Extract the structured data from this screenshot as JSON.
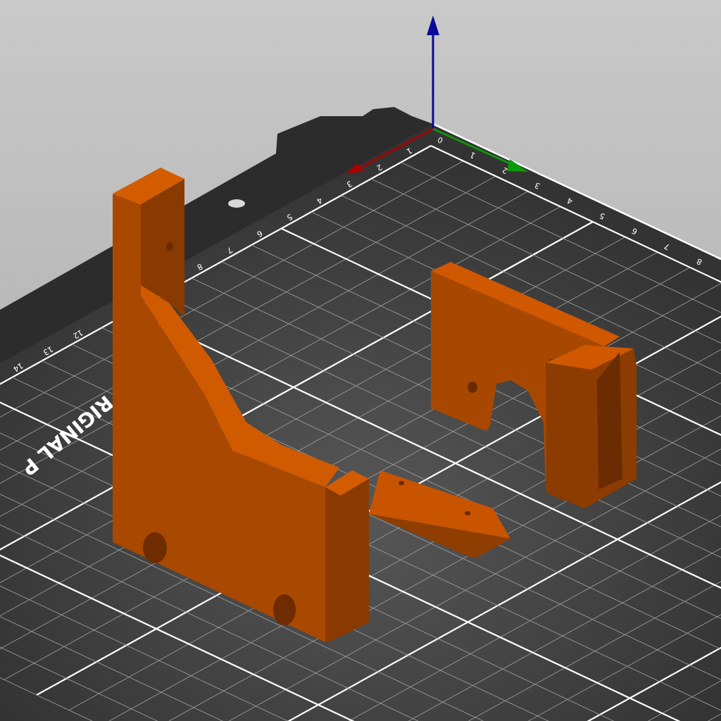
{
  "viewport": {
    "bed": {
      "origin_label": "0",
      "x_ticks_near": [
        "1",
        "2",
        "3",
        "4",
        "5",
        "6",
        "7",
        "8"
      ],
      "x_ticks_far": [
        "12",
        "13",
        "14"
      ],
      "y_ticks": [
        "1",
        "2",
        "3",
        "4",
        "5",
        "6",
        "7",
        "8"
      ],
      "logo_text": "RIGINAL P"
    }
  }
}
